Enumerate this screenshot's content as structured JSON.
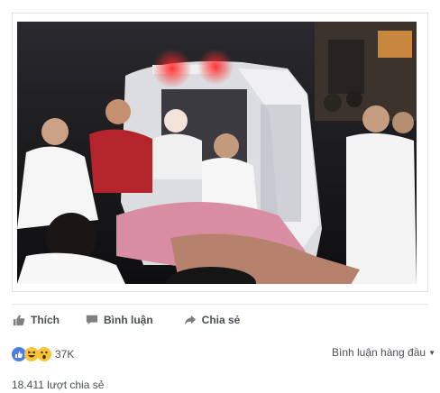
{
  "post": {
    "image_alt_icon": "photo-icon"
  },
  "actions": {
    "like_label": "Thích",
    "comment_label": "Bình luận",
    "share_label": "Chia sẻ"
  },
  "reactions": {
    "count": "37K",
    "types": [
      "like",
      "haha",
      "wow"
    ],
    "colors": {
      "like": "#4c7de6",
      "emoji": "#f7c43a"
    }
  },
  "comments_filter": {
    "label": "Bình luận hàng đầu"
  },
  "shares": {
    "label": "18.411 lượt chia sẻ"
  }
}
